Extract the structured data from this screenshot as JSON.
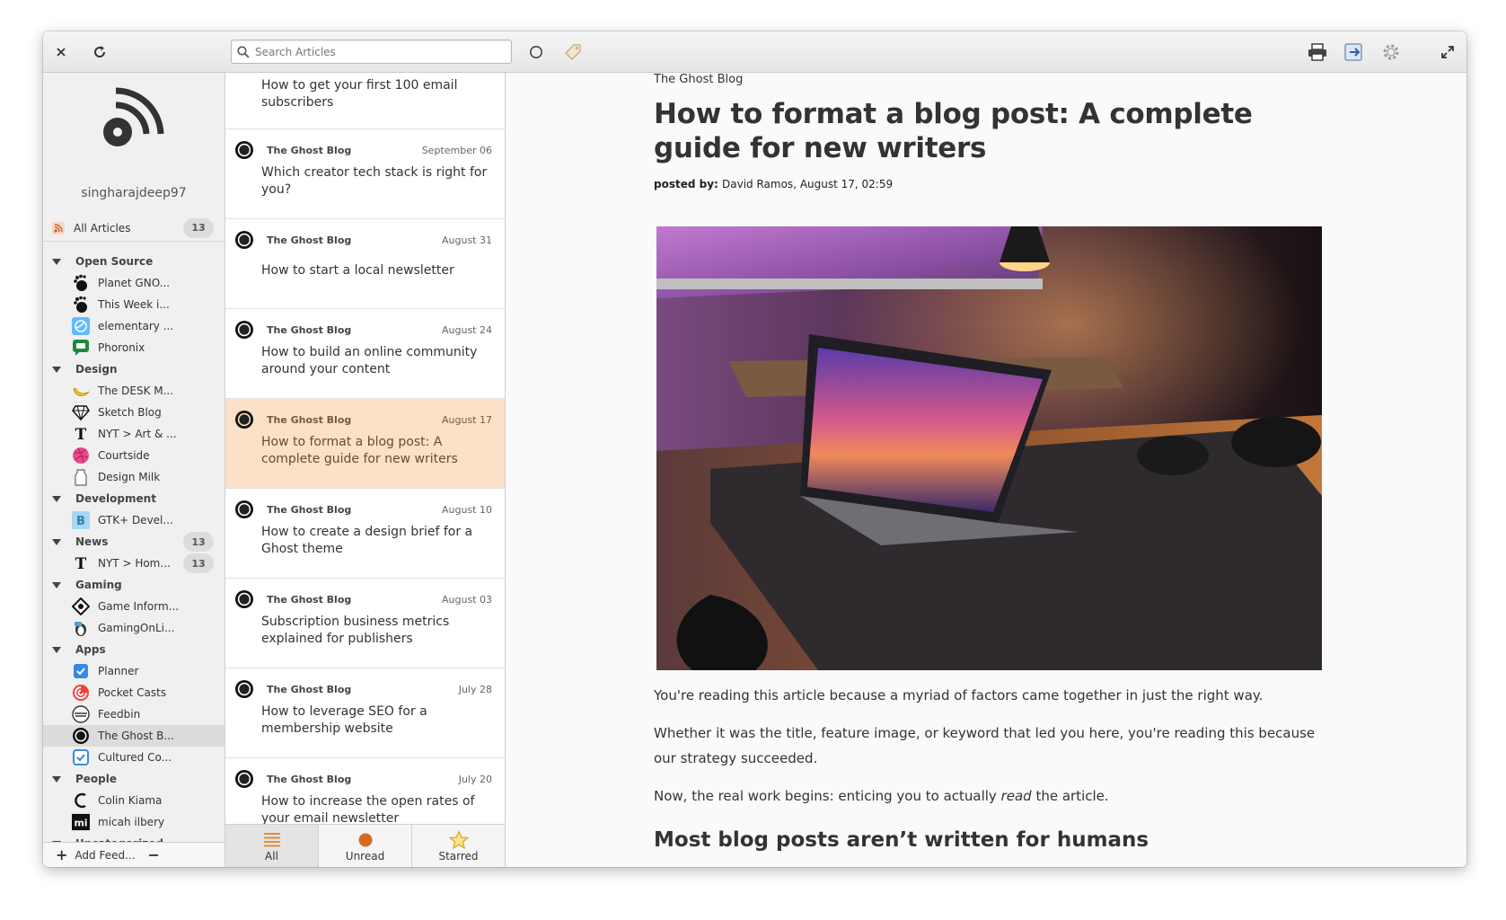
{
  "toolbar": {
    "search_placeholder": "Search Articles"
  },
  "sidebar": {
    "username": "singharajdeep97",
    "all_articles": {
      "label": "All Articles",
      "count": "13"
    },
    "categories": [
      {
        "label": "Open Source",
        "feeds": [
          "Planet GNO...",
          "This Week i...",
          "elementary ...",
          "Phoronix"
        ]
      },
      {
        "label": "Design",
        "feeds": [
          "The DESK M...",
          "Sketch Blog",
          "NYT > Art & ...",
          "Courtside",
          "Design Milk"
        ]
      },
      {
        "label": "Development",
        "feeds": [
          "GTK+ Devel..."
        ]
      },
      {
        "label": "News",
        "count": "13",
        "feeds": [
          "NYT > Hom..."
        ],
        "feed_count": "13"
      },
      {
        "label": "Gaming",
        "feeds": [
          "Game Inform...",
          "GamingOnLi..."
        ]
      },
      {
        "label": "Apps",
        "feeds": [
          "Planner",
          "Pocket Casts",
          "Feedbin",
          "The Ghost B...",
          "Cultured Co..."
        ]
      },
      {
        "label": "People",
        "feeds": [
          "Colin Kiama",
          "micah ilbery"
        ]
      },
      {
        "label": "Uncategorized",
        "feeds": []
      }
    ],
    "footer": {
      "add_label": "Add Feed..."
    }
  },
  "articles": [
    {
      "source": "",
      "date": "",
      "title": "How to get your first 100 email subscribers"
    },
    {
      "source": "The Ghost Blog",
      "date": "September 06",
      "title": "Which creator tech stack is right for you?"
    },
    {
      "source": "The Ghost Blog",
      "date": "August 31",
      "title": "How to start a local newsletter"
    },
    {
      "source": "The Ghost Blog",
      "date": "August 24",
      "title": "How to build an online community around your content"
    },
    {
      "source": "The Ghost Blog",
      "date": "August 17",
      "title": "How to format a blog post: A complete guide for new writers"
    },
    {
      "source": "The Ghost Blog",
      "date": "August 10",
      "title": "How to create a design brief for a Ghost theme"
    },
    {
      "source": "The Ghost Blog",
      "date": "August 03",
      "title": "Subscription business metrics explained for publishers"
    },
    {
      "source": "The Ghost Blog",
      "date": "July 28",
      "title": "How to leverage SEO for a membership website"
    },
    {
      "source": "The Ghost Blog",
      "date": "July 20",
      "title": "How to increase the open rates of your email newsletter"
    }
  ],
  "list_tabs": {
    "all": "All",
    "unread": "Unread",
    "starred": "Starred"
  },
  "reader": {
    "source": "The Ghost Blog",
    "title": "How to format a blog post: A complete guide for new writers",
    "meta_prefix": "posted by: ",
    "meta_author_date": "David Ramos, August 17, 02:59",
    "p1": "You're reading this article because a myriad of factors came together in just the right way.",
    "p2": "Whether it was the title, feature image, or keyword that led you here, you're reading this because our strategy succeeded.",
    "p3_before": "Now, the real work begins: enticing you to actually ",
    "p3_em": "read",
    "p3_after": " the article.",
    "h2": "Most blog posts aren’t written for humans"
  },
  "colors": {
    "selected_article": "#fde0c8",
    "accent": "#e8710a"
  }
}
